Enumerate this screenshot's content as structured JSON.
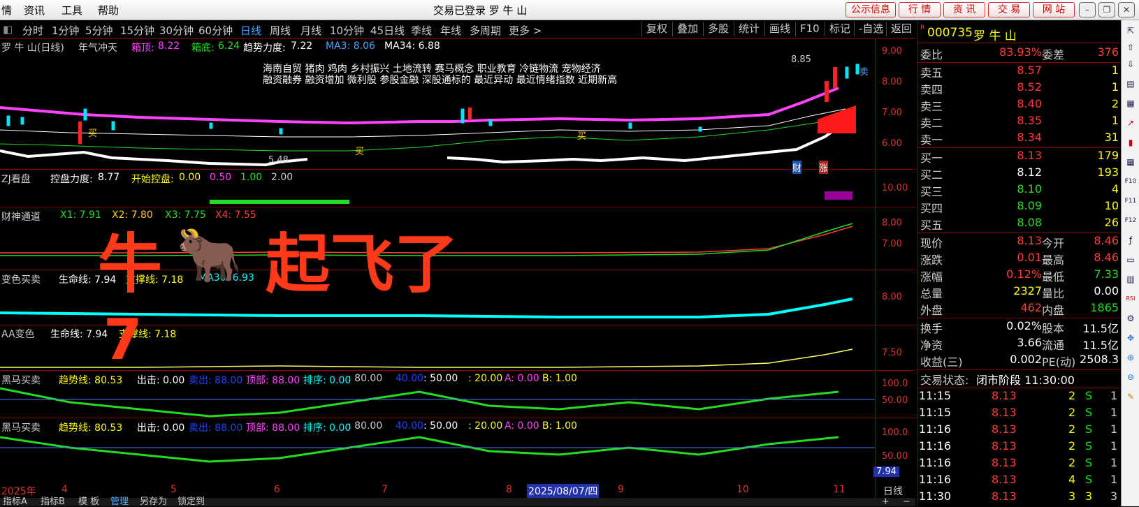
{
  "menu": {
    "items": [
      "情",
      "资讯",
      "工具",
      "帮助"
    ],
    "window_title": "交易已登录  罗 牛 山",
    "buttons": [
      "公示信息",
      "行  情",
      "资  讯",
      "交  易",
      "网  站"
    ]
  },
  "toolbar": {
    "periods": [
      "分时",
      "1分钟",
      "5分钟",
      "15分钟",
      "30分钟",
      "60分钟",
      "日线",
      "周线",
      "月线",
      "10分钟",
      "45日线",
      "季线",
      "年线",
      "多周期",
      "更多 >"
    ],
    "active": "日线",
    "tools": [
      "复权",
      "叠加",
      "多股",
      "统计",
      "画线",
      "F10",
      "标记",
      "-自选",
      "返回"
    ]
  },
  "main_panel": {
    "header": {
      "name": "罗 牛 山(日线)",
      "indicator": "年气冲天",
      "top_label": "箱顶:",
      "top_val": "8.22",
      "bot_label": "箱底:",
      "bot_val": "6.24",
      "trend_label": "趋势力度:",
      "trend_val": "7.22",
      "ma3": "MA3: 8.06",
      "ma34": "MA34: 6.88"
    },
    "concepts_line1": "海南自贸 猪肉 鸡肉 乡村振兴 土地流转 赛马概念 职业教育 冷链物流 宠物经济",
    "concepts_line2": "融资融券 融资增加 微利股 参股金融 深股通标的 最近异动 最近情绪指数 近期新高",
    "high_label": "8.85",
    "low_label": "5.48",
    "signals": {
      "buy": "买",
      "sell": "卖",
      "cai": "财",
      "zhang": "涨"
    },
    "yticks": [
      "9.00",
      "8.00",
      "7.00",
      "6.00"
    ]
  },
  "zj_panel": {
    "name": "ZJ看盘",
    "kp_label": "控盘力度:",
    "kp_val": "8.77",
    "start_label": "开始控盘:",
    "v1": "0.00",
    "v2": "0.50",
    "v3": "1.00",
    "v4": "2.00",
    "ytick": "10.00"
  },
  "cs_panel": {
    "name": "财神通道",
    "x1": "X1: 7.91",
    "x2": "X2: 7.80",
    "x3": "X3: 7.75",
    "x4": "X4: 7.55",
    "yticks": [
      "8.00",
      "7.00"
    ]
  },
  "overlay": {
    "text": "牛",
    "text2": "起飞了",
    "text3": "7",
    "ox": "🐂"
  },
  "bs_panel": {
    "name": "变色买卖",
    "life": "生命线: 7.94",
    "support": "支撑线: 7.18",
    "ma30": "MA30: 6.93",
    "ytick": "8.00"
  },
  "aa_panel": {
    "name": "AA变色",
    "life": "生命线: 7.94",
    "support": "支撑线: 7.18",
    "ytick": "7.50"
  },
  "hm_panel": {
    "name": "黑马买卖",
    "trend": "趋势线: 80.53",
    "out": "出击: 0.00",
    "sell": "卖出: 88.00",
    "top": "顶部: 88.00",
    "sort": "排序: 0.00",
    "v80": ": 80.00",
    "v40": "40.00",
    "v50": ": 50.00",
    "v20": ": 20.00",
    "a": "A: 0.00",
    "b": "B: 1.00",
    "yticks": [
      "100.0",
      "50.00"
    ]
  },
  "time_axis": {
    "year": "2025年",
    "months": [
      "4",
      "5",
      "6",
      "7",
      "8",
      "9",
      "10",
      "11"
    ],
    "cursor_date": "2025/08/07/四",
    "cursor_val": "7.94",
    "period": "日线"
  },
  "bottom_tabs": [
    "指标A",
    "指标B",
    "模 板",
    "管理",
    "另存为",
    "锁定到"
  ],
  "quote": {
    "code_prefix": "R",
    "code": "000735",
    "name": "罗 牛 山",
    "weibi_label": "委比",
    "weibi": "83.93%",
    "weicha_label": "委差",
    "weicha": "376",
    "sells": [
      {
        "label": "卖五",
        "price": "8.57",
        "vol": "1"
      },
      {
        "label": "卖四",
        "price": "8.52",
        "vol": "1"
      },
      {
        "label": "卖三",
        "price": "8.40",
        "vol": "2"
      },
      {
        "label": "卖二",
        "price": "8.35",
        "vol": "1"
      },
      {
        "label": "卖一",
        "price": "8.34",
        "vol": "31"
      }
    ],
    "buys": [
      {
        "label": "买一",
        "price": "8.13",
        "vol": "179"
      },
      {
        "label": "买二",
        "price": "8.12",
        "vol": "193"
      },
      {
        "label": "买三",
        "price": "8.10",
        "vol": "4"
      },
      {
        "label": "买四",
        "price": "8.09",
        "vol": "10"
      },
      {
        "label": "买五",
        "price": "8.08",
        "vol": "26"
      }
    ],
    "stats": [
      {
        "k": "现价",
        "v": "8.13",
        "k2": "今开",
        "v2": "8.46"
      },
      {
        "k": "涨跌",
        "v": "0.01",
        "k2": "最高",
        "v2": "8.46"
      },
      {
        "k": "涨幅",
        "v": "0.12%",
        "k2": "最低",
        "v2": "7.33"
      },
      {
        "k": "总量",
        "v": "2327",
        "k2": "量比",
        "v2": "0.00"
      },
      {
        "k": "外盘",
        "v": "462",
        "k2": "内盘",
        "v2": "1865"
      },
      {
        "k": "换手",
        "v": "0.02%",
        "k2": "股本",
        "v2": "11.5亿"
      },
      {
        "k": "净资",
        "v": "3.66",
        "k2": "流通",
        "v2": "11.5亿"
      },
      {
        "k": "收益(三)",
        "v": "0.002",
        "k2": "PE(动)",
        "v2": "2508.3"
      }
    ],
    "status_label": "交易状态:",
    "status": "闭市阶段 11:30:00",
    "ticks": [
      {
        "t": "11:15",
        "p": "8.13",
        "v": "2",
        "d": "S",
        "n": "1"
      },
      {
        "t": "11:15",
        "p": "8.13",
        "v": "2",
        "d": "S",
        "n": "1"
      },
      {
        "t": "11:16",
        "p": "8.13",
        "v": "2",
        "d": "S",
        "n": "1"
      },
      {
        "t": "11:16",
        "p": "8.13",
        "v": "2",
        "d": "S",
        "n": "1"
      },
      {
        "t": "11:16",
        "p": "8.13",
        "v": "2",
        "d": "S",
        "n": "1"
      },
      {
        "t": "11:16",
        "p": "8.13",
        "v": "4",
        "d": "S",
        "n": "1"
      },
      {
        "t": "11:30",
        "p": "8.13",
        "v": "3",
        "d": "3",
        "n": "3"
      }
    ]
  },
  "sidebar_icons": [
    "pin-icon",
    "arrow-up-icon",
    "arrow-down-icon",
    "layout-icon",
    "table-icon",
    "chart-up-icon",
    "candle-icon",
    "grid-icon",
    "f10-icon",
    "f11-icon",
    "f12-icon",
    "function-icon",
    "doc-icon",
    "bar-icon",
    "rsi-icon",
    "gear-icon",
    "move-icon",
    "zoom-in-icon",
    "zoom-out-icon",
    "pen-icon"
  ]
}
